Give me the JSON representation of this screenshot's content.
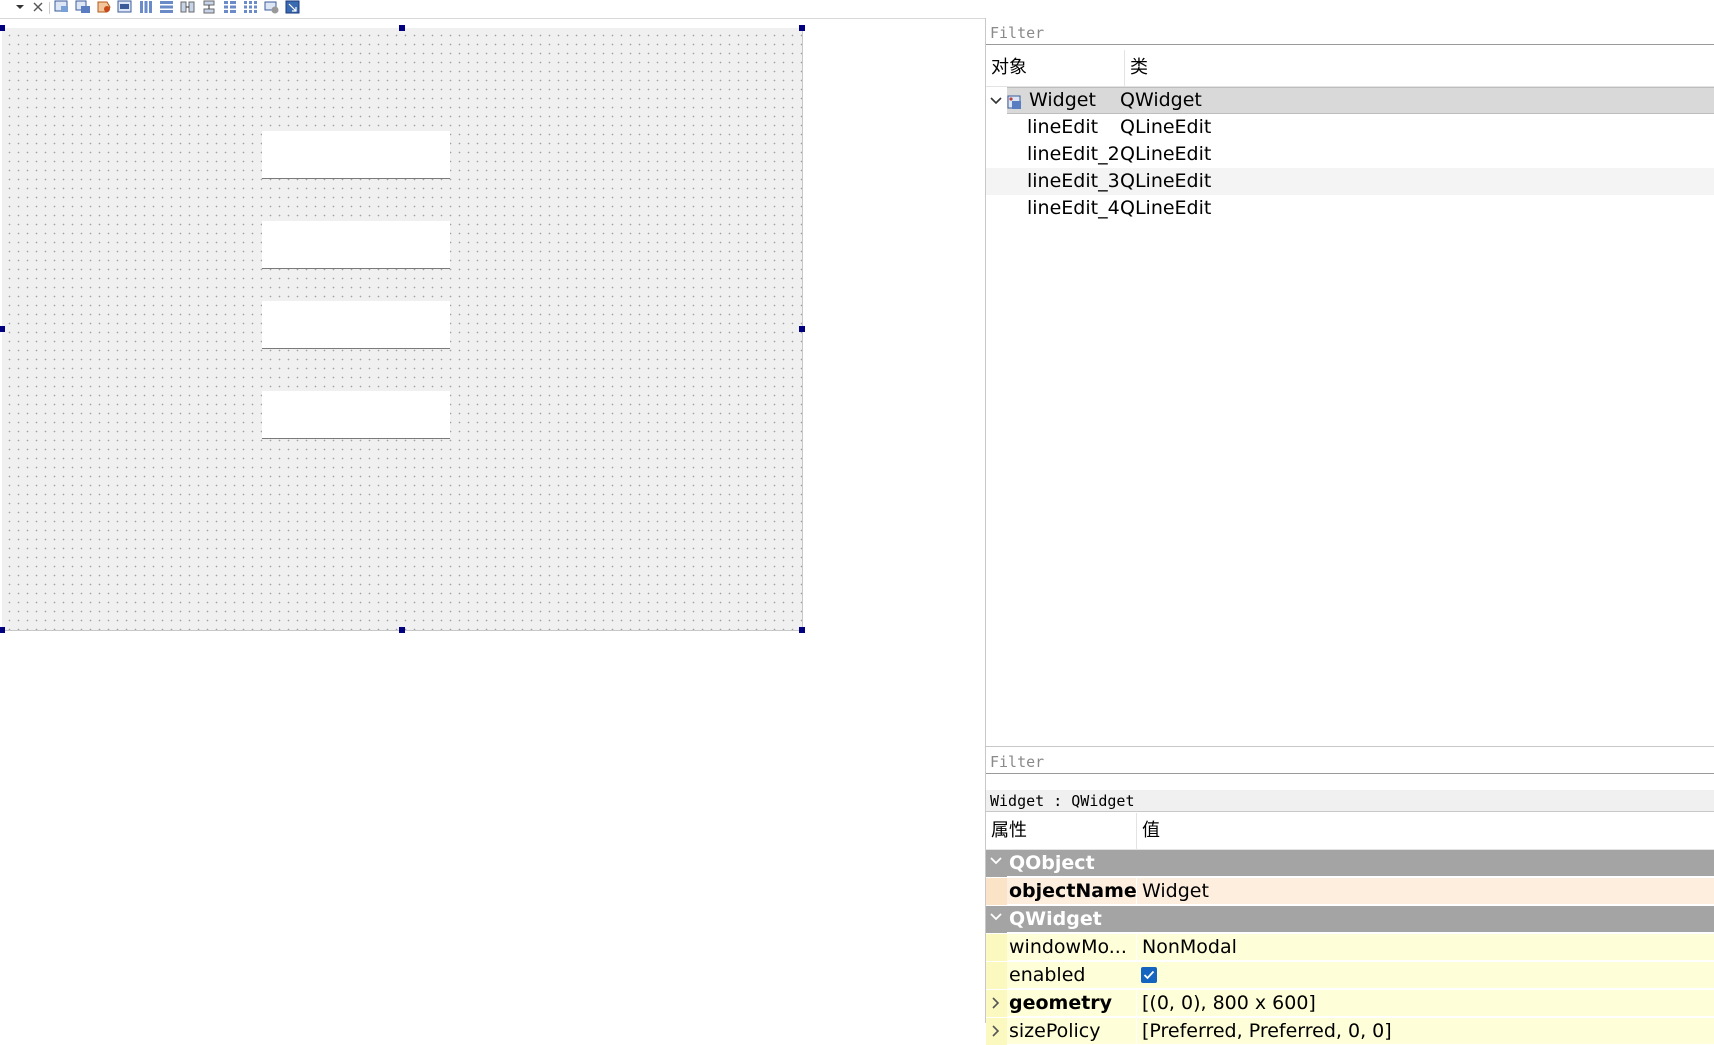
{
  "toolbar": {
    "buttons": [
      {
        "icon": "dropdown-arrow-icon"
      },
      {
        "icon": "close-icon"
      },
      {
        "icon": "edit-widgets-icon"
      },
      {
        "icon": "edit-signals-slots-icon"
      },
      {
        "icon": "edit-buddies-icon"
      },
      {
        "icon": "edit-tab-order-icon"
      },
      {
        "icon": "layout-horizontal-icon"
      },
      {
        "icon": "layout-vertical-icon"
      },
      {
        "icon": "layout-horizontal-splitter-icon"
      },
      {
        "icon": "layout-vertical-splitter-icon"
      },
      {
        "icon": "layout-form-icon"
      },
      {
        "icon": "layout-grid-icon"
      },
      {
        "icon": "break-layout-icon"
      },
      {
        "icon": "adjust-size-icon"
      }
    ]
  },
  "form": {
    "line_edits": [
      "lineEdit",
      "lineEdit_2",
      "lineEdit_3",
      "lineEdit_4"
    ]
  },
  "object_inspector": {
    "filter_placeholder": "Filter",
    "col_object": "对象",
    "col_class": "类",
    "root": {
      "name": "Widget",
      "class": "QWidget"
    },
    "children": [
      {
        "name": "lineEdit",
        "class": "QLineEdit"
      },
      {
        "name": "lineEdit_2",
        "class": "QLineEdit"
      },
      {
        "name": "lineEdit_3",
        "class": "QLineEdit"
      },
      {
        "name": "lineEdit_4",
        "class": "QLineEdit"
      }
    ]
  },
  "property_editor": {
    "filter_placeholder": "Filter",
    "subject": "Widget : QWidget",
    "col_property": "属性",
    "col_value": "值",
    "groups": {
      "qobject": "QObject",
      "qwidget": "QWidget"
    },
    "rows": {
      "objectName": {
        "name": "objectName",
        "value": "Widget"
      },
      "windowModality": {
        "name": "windowMo...",
        "value": "NonModal"
      },
      "enabled": {
        "name": "enabled",
        "value": true
      },
      "geometry": {
        "name": "geometry",
        "value": "[(0, 0), 800 x 600]"
      },
      "sizePolicy": {
        "name": "sizePolicy",
        "value": "[Preferred, Preferred, 0, 0]"
      }
    }
  },
  "colors": {
    "selection_handle": "#000080",
    "group_row": "#a4a4a4",
    "qobject_row": "#fdeedd",
    "qwidget_row": "#fefed8",
    "checkbox_accent": "#1565c0"
  }
}
